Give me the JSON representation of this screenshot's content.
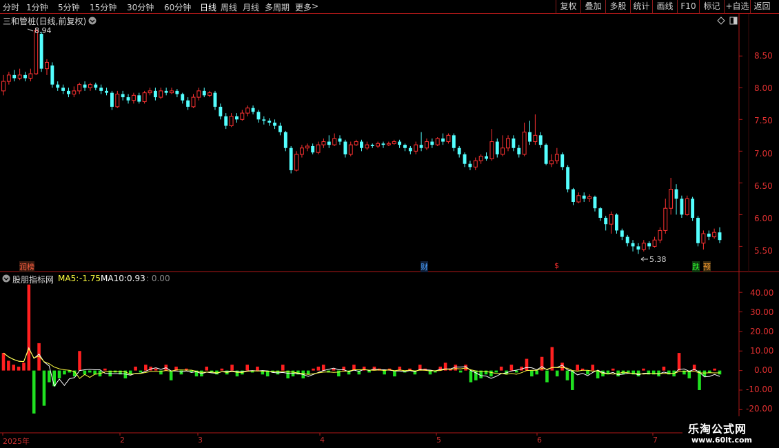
{
  "toolbar": {
    "periods": [
      "分时",
      "1分钟",
      "5分钟",
      "15分钟",
      "30分钟",
      "60分钟",
      "日线",
      "周线",
      "月线",
      "多周期",
      "更多"
    ],
    "active_period": "日线",
    "more_arrow": ">",
    "right_buttons": [
      "复权",
      "叠加",
      "多股",
      "统计",
      "画线",
      "F10",
      "标记",
      "+自选",
      "返回"
    ]
  },
  "main_chart": {
    "title": "三和管桩(日线,前复权)",
    "high_label": "8.94",
    "low_label": "5.38",
    "event_marks": [
      {
        "text": "润榜",
        "color": "#ff6040"
      },
      {
        "text": "财",
        "color": "#4aa0ff"
      },
      {
        "text": "$",
        "color": "#ff3030"
      },
      {
        "text": "跌",
        "color": "#30ff30"
      },
      {
        "text": "预",
        "color": "#ffa030"
      }
    ]
  },
  "indicator": {
    "name": "股朋指标网",
    "ma5_label": "MA5:",
    "ma5_value": "-1.75",
    "ma10_label": "MA10:",
    "ma10_value": "0.93",
    "extra_value": ": 0.00"
  },
  "colors": {
    "up": "#ff3232",
    "down": "#54ffff",
    "volume_up": "#ff2020",
    "volume_down": "#20e020",
    "ma5": "#ffffff",
    "ma10": "#ffff40",
    "border": "#b01818"
  },
  "watermark": {
    "line1": "乐淘公式网",
    "line2": "www.60lt.com"
  },
  "chart_data": [
    {
      "type": "candlestick",
      "title": "三和管桩(日线,前复权)",
      "y_ticks": [
        "8.50",
        "8.00",
        "7.50",
        "7.00",
        "6.50",
        "6.00",
        "5.50"
      ],
      "ylim": [
        5.32,
        9.1
      ],
      "x_ticks": [
        "2025年",
        "2",
        "3",
        "4",
        "5",
        "6",
        "7"
      ],
      "candles": [
        [
          7.95,
          8.1,
          8.2,
          7.88
        ],
        [
          8.1,
          8.2,
          8.25,
          8.05
        ],
        [
          8.2,
          8.15,
          8.28,
          8.1
        ],
        [
          8.15,
          8.2,
          8.3,
          8.12
        ],
        [
          8.2,
          8.15,
          8.25,
          8.1
        ],
        [
          8.15,
          8.22,
          8.3,
          8.1
        ],
        [
          8.22,
          8.9,
          8.94,
          8.2
        ],
        [
          8.85,
          8.3,
          8.88,
          8.25
        ],
        [
          8.3,
          8.4,
          8.45,
          8.2
        ],
        [
          8.35,
          8.05,
          8.4,
          8.0
        ],
        [
          8.05,
          8.0,
          8.1,
          7.95
        ],
        [
          8.0,
          7.95,
          8.05,
          7.9
        ],
        [
          7.95,
          7.9,
          8.0,
          7.85
        ],
        [
          7.9,
          7.95,
          8.02,
          7.85
        ],
        [
          7.95,
          8.05,
          8.08,
          7.9
        ],
        [
          8.05,
          8.0,
          8.1,
          7.95
        ],
        [
          8.0,
          8.05,
          8.08,
          7.95
        ],
        [
          8.05,
          8.0,
          8.08,
          7.96
        ],
        [
          8.0,
          7.95,
          8.05,
          7.9
        ],
        [
          7.95,
          7.92,
          8.0,
          7.88
        ],
        [
          7.92,
          7.7,
          7.95,
          7.65
        ],
        [
          7.7,
          7.9,
          7.95,
          7.68
        ],
        [
          7.9,
          7.85,
          7.95,
          7.8
        ],
        [
          7.85,
          7.8,
          7.9,
          7.75
        ],
        [
          7.8,
          7.88,
          7.92,
          7.75
        ],
        [
          7.88,
          7.78,
          7.92,
          7.75
        ],
        [
          7.78,
          7.92,
          7.95,
          7.75
        ],
        [
          7.92,
          7.95,
          8.0,
          7.88
        ],
        [
          7.95,
          7.85,
          8.0,
          7.8
        ],
        [
          7.85,
          7.95,
          8.0,
          7.82
        ],
        [
          7.95,
          7.92,
          8.0,
          7.88
        ],
        [
          7.92,
          7.95,
          8.0,
          7.9
        ],
        [
          7.95,
          7.9,
          7.98,
          7.85
        ],
        [
          7.9,
          7.8,
          7.92,
          7.75
        ],
        [
          7.8,
          7.7,
          7.85,
          7.65
        ],
        [
          7.7,
          7.85,
          7.9,
          7.68
        ],
        [
          7.85,
          7.95,
          8.0,
          7.8
        ],
        [
          7.95,
          7.88,
          8.0,
          7.85
        ],
        [
          7.88,
          7.92,
          7.95,
          7.85
        ],
        [
          7.92,
          7.7,
          7.95,
          7.65
        ],
        [
          7.7,
          7.55,
          7.75,
          7.5
        ],
        [
          7.55,
          7.4,
          7.6,
          7.35
        ],
        [
          7.4,
          7.55,
          7.6,
          7.38
        ],
        [
          7.55,
          7.5,
          7.6,
          7.45
        ],
        [
          7.5,
          7.6,
          7.65,
          7.48
        ],
        [
          7.6,
          7.68,
          7.72,
          7.55
        ],
        [
          7.68,
          7.62,
          7.72,
          7.58
        ],
        [
          7.62,
          7.5,
          7.65,
          7.45
        ],
        [
          7.5,
          7.48,
          7.55,
          7.42
        ],
        [
          7.48,
          7.45,
          7.52,
          7.4
        ],
        [
          7.45,
          7.4,
          7.5,
          7.35
        ],
        [
          7.4,
          7.3,
          7.45,
          7.25
        ],
        [
          7.3,
          7.05,
          7.32,
          7.0
        ],
        [
          7.05,
          6.7,
          7.08,
          6.65
        ],
        [
          6.7,
          6.95,
          7.0,
          6.68
        ],
        [
          6.95,
          7.05,
          7.1,
          6.9
        ],
        [
          7.05,
          7.08,
          7.12,
          7.0
        ],
        [
          7.08,
          6.98,
          7.12,
          6.95
        ],
        [
          6.98,
          7.1,
          7.15,
          6.95
        ],
        [
          7.1,
          7.15,
          7.2,
          7.05
        ],
        [
          7.15,
          7.1,
          7.25,
          7.05
        ],
        [
          7.1,
          7.2,
          7.28,
          7.08
        ],
        [
          7.2,
          7.15,
          7.25,
          7.1
        ],
        [
          7.15,
          6.95,
          7.18,
          6.9
        ],
        [
          6.95,
          7.1,
          7.15,
          6.92
        ],
        [
          7.1,
          7.15,
          7.18,
          7.08
        ],
        [
          7.15,
          7.05,
          7.18,
          7.0
        ],
        [
          7.05,
          7.1,
          7.15,
          7.02
        ],
        [
          7.1,
          7.08,
          7.12,
          7.05
        ],
        [
          7.08,
          7.12,
          7.15,
          7.05
        ],
        [
          7.12,
          7.1,
          7.15,
          7.05
        ],
        [
          7.1,
          7.12,
          7.15,
          7.08
        ],
        [
          7.12,
          7.15,
          7.18,
          7.1
        ],
        [
          7.15,
          7.1,
          7.18,
          7.05
        ],
        [
          7.1,
          7.05,
          7.12,
          7.0
        ],
        [
          7.05,
          7.0,
          7.08,
          6.95
        ],
        [
          7.0,
          7.1,
          7.15,
          6.95
        ],
        [
          7.1,
          7.05,
          7.3,
          7.0
        ],
        [
          7.05,
          7.15,
          7.2,
          7.02
        ],
        [
          7.15,
          7.1,
          7.2,
          7.05
        ],
        [
          7.1,
          7.2,
          7.22,
          7.08
        ],
        [
          7.2,
          7.15,
          7.28,
          7.1
        ],
        [
          7.15,
          7.25,
          7.28,
          7.12
        ],
        [
          7.25,
          7.05,
          7.28,
          7.0
        ],
        [
          7.05,
          6.95,
          7.08,
          6.9
        ],
        [
          6.95,
          6.8,
          6.98,
          6.75
        ],
        [
          6.8,
          6.75,
          6.85,
          6.7
        ],
        [
          6.75,
          6.85,
          6.9,
          6.7
        ],
        [
          6.85,
          6.92,
          6.95,
          6.8
        ],
        [
          6.92,
          6.88,
          6.98,
          6.85
        ],
        [
          6.88,
          7.15,
          7.35,
          6.85
        ],
        [
          7.15,
          6.95,
          7.2,
          6.9
        ],
        [
          6.95,
          7.05,
          7.25,
          6.92
        ],
        [
          7.05,
          7.2,
          7.25,
          7.0
        ],
        [
          7.2,
          7.05,
          7.25,
          7.0
        ],
        [
          7.05,
          6.95,
          7.1,
          6.9
        ],
        [
          6.95,
          7.3,
          7.45,
          6.92
        ],
        [
          7.3,
          7.15,
          7.48,
          7.1
        ],
        [
          7.15,
          7.25,
          7.58,
          7.1
        ],
        [
          7.25,
          7.1,
          7.3,
          7.05
        ],
        [
          7.1,
          6.8,
          7.12,
          6.78
        ],
        [
          6.8,
          6.85,
          6.95,
          6.75
        ],
        [
          6.85,
          6.95,
          7.05,
          6.8
        ],
        [
          6.95,
          6.75,
          6.98,
          6.7
        ],
        [
          6.75,
          6.4,
          6.78,
          6.35
        ],
        [
          6.4,
          6.2,
          6.42,
          6.15
        ],
        [
          6.2,
          6.3,
          6.35,
          6.18
        ],
        [
          6.3,
          6.25,
          6.35,
          6.2
        ],
        [
          6.25,
          6.28,
          6.32,
          6.2
        ],
        [
          6.28,
          6.1,
          6.3,
          6.05
        ],
        [
          6.1,
          5.95,
          6.12,
          5.9
        ],
        [
          5.95,
          5.85,
          5.98,
          5.75
        ],
        [
          5.85,
          6.0,
          6.05,
          5.7
        ],
        [
          6.0,
          5.75,
          6.02,
          5.7
        ],
        [
          5.75,
          5.65,
          5.78,
          5.6
        ],
        [
          5.65,
          5.55,
          5.68,
          5.5
        ],
        [
          5.55,
          5.5,
          5.6,
          5.42
        ],
        [
          5.5,
          5.45,
          5.55,
          5.38
        ],
        [
          5.45,
          5.55,
          5.6,
          5.42
        ],
        [
          5.55,
          5.5,
          5.58,
          5.45
        ],
        [
          5.5,
          5.6,
          5.65,
          5.48
        ],
        [
          5.6,
          5.75,
          5.8,
          5.55
        ],
        [
          5.75,
          6.1,
          6.25,
          5.7
        ],
        [
          6.1,
          6.4,
          6.58,
          6.0
        ],
        [
          6.4,
          6.25,
          6.48,
          6.0
        ],
        [
          6.25,
          6.0,
          6.3,
          5.95
        ],
        [
          6.0,
          6.25,
          6.3,
          5.98
        ],
        [
          6.25,
          5.95,
          6.28,
          5.9
        ],
        [
          5.95,
          5.55,
          5.98,
          5.5
        ],
        [
          5.55,
          5.7,
          5.75,
          5.45
        ],
        [
          5.7,
          5.65,
          5.75,
          5.6
        ],
        [
          5.65,
          5.72,
          5.78,
          5.62
        ],
        [
          5.72,
          5.6,
          5.8,
          5.55
        ]
      ]
    },
    {
      "type": "bar",
      "title": "股朋指标网",
      "y_ticks": [
        "40.00",
        "30.00",
        "20.00",
        "10.00",
        "0.00",
        "-10.00",
        "-20.00"
      ],
      "ylim": [
        -22,
        45
      ],
      "values": [
        9,
        5,
        3,
        2,
        4,
        44,
        -22,
        14,
        -18,
        -6,
        -8,
        -4,
        -2,
        -1,
        -3,
        10,
        -2,
        -1,
        -2,
        -3,
        1,
        -3,
        -1,
        -2,
        -4,
        -2,
        2,
        -1,
        3,
        2,
        1,
        -2,
        3,
        -5,
        2,
        -2,
        1,
        -1,
        -3,
        -3,
        2,
        -1,
        -2,
        1,
        -2,
        3,
        -3,
        -2,
        3,
        -1,
        2,
        -2,
        -3,
        -1,
        -2,
        3,
        -4,
        -3,
        -2,
        -4,
        -2,
        1,
        2,
        3,
        -1,
        1,
        -3,
        2,
        -2,
        3,
        -2,
        2,
        -1,
        2,
        1,
        -2,
        1,
        -3,
        2,
        -1,
        1,
        -2,
        3,
        1,
        -2,
        -1,
        2,
        4,
        1,
        3,
        -1,
        3,
        -6,
        -5,
        -4,
        -2,
        -3,
        -1,
        2,
        -2,
        3,
        -1,
        2,
        6,
        -3,
        -2,
        7,
        -6,
        12,
        -3,
        4,
        -5,
        -10,
        3,
        1,
        -2,
        3,
        -4,
        -3,
        -2,
        1,
        -3,
        -2,
        -1,
        -2,
        -3,
        1,
        -2,
        -2,
        -3,
        2,
        -2,
        -3,
        9,
        -2,
        -4,
        3,
        -10,
        -3,
        -1,
        1,
        -2
      ]
    }
  ]
}
